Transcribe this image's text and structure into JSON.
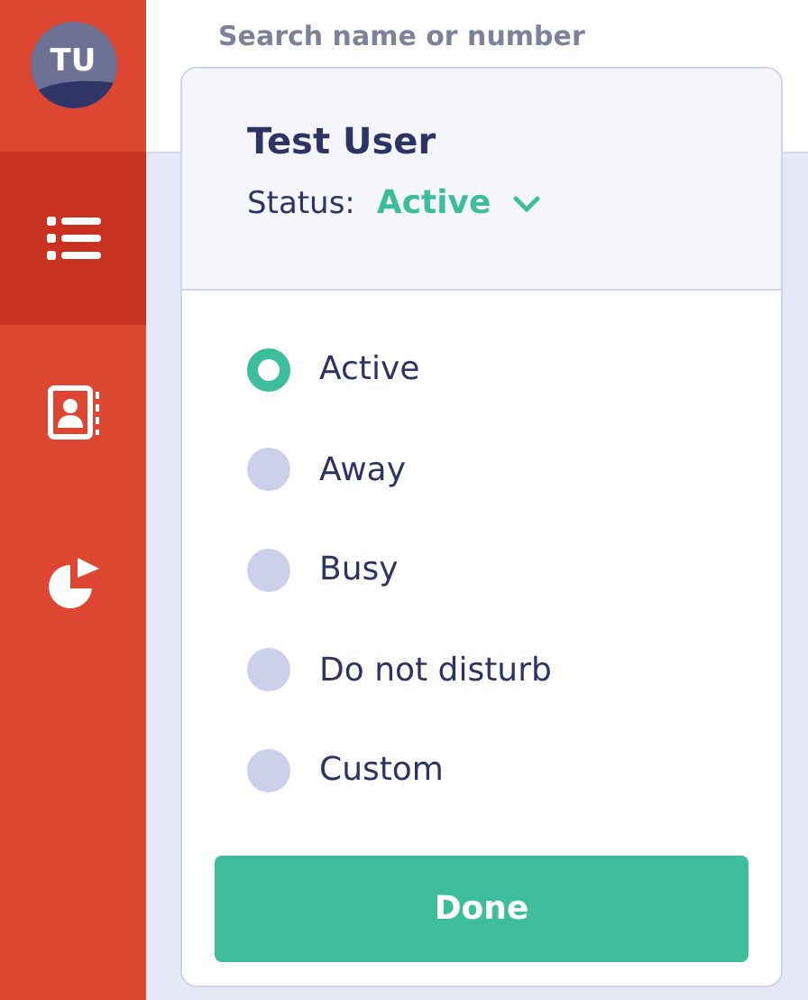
{
  "sidebar": {
    "avatar": {
      "initials": "TU"
    },
    "items": [
      {
        "kind": "list",
        "selected": true
      },
      {
        "kind": "contacts",
        "selected": false
      },
      {
        "kind": "chart",
        "selected": false
      }
    ]
  },
  "search": {
    "placeholder": "Search name or number"
  },
  "status_popup": {
    "user_name": "Test User",
    "status_label": "Status:",
    "current_status": "Active",
    "options": [
      {
        "label": "Active",
        "selected": true
      },
      {
        "label": "Away",
        "selected": false
      },
      {
        "label": "Busy",
        "selected": false
      },
      {
        "label": "Do not disturb",
        "selected": false
      },
      {
        "label": "Custom",
        "selected": false
      }
    ],
    "done_button": "Done"
  }
}
